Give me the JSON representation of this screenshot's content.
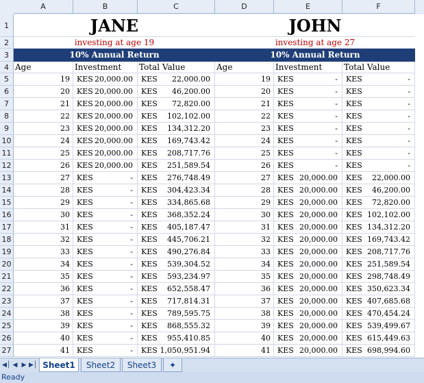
{
  "columns": [
    "A",
    "B",
    "C",
    "D",
    "E",
    "F"
  ],
  "titles": {
    "left": "JANE",
    "right": "JOHN"
  },
  "subtitles": {
    "left": "investing at age 19",
    "right": "investing at age 27"
  },
  "band": {
    "left": "10% Annual Return",
    "right": "10% Annual Return"
  },
  "headers": {
    "age": "Age",
    "investment": "Investment",
    "total": "Total Value"
  },
  "currency": "KES",
  "jane": [
    {
      "age": "19",
      "inv": "20,000.00",
      "tot": "22,000.00"
    },
    {
      "age": "20",
      "inv": "20,000.00",
      "tot": "46,200.00"
    },
    {
      "age": "21",
      "inv": "20,000.00",
      "tot": "72,820.00"
    },
    {
      "age": "22",
      "inv": "20,000.00",
      "tot": "102,102.00"
    },
    {
      "age": "23",
      "inv": "20,000.00",
      "tot": "134,312.20"
    },
    {
      "age": "24",
      "inv": "20,000.00",
      "tot": "169,743.42"
    },
    {
      "age": "25",
      "inv": "20,000.00",
      "tot": "208,717.76"
    },
    {
      "age": "26",
      "inv": "20,000.00",
      "tot": "251,589.54"
    },
    {
      "age": "27",
      "inv": "-",
      "tot": "276,748.49"
    },
    {
      "age": "28",
      "inv": "-",
      "tot": "304,423.34"
    },
    {
      "age": "29",
      "inv": "-",
      "tot": "334,865.68"
    },
    {
      "age": "30",
      "inv": "-",
      "tot": "368,352.24"
    },
    {
      "age": "31",
      "inv": "-",
      "tot": "405,187.47"
    },
    {
      "age": "32",
      "inv": "-",
      "tot": "445,706.21"
    },
    {
      "age": "33",
      "inv": "-",
      "tot": "490,276.84"
    },
    {
      "age": "34",
      "inv": "-",
      "tot": "539,304.52"
    },
    {
      "age": "35",
      "inv": "-",
      "tot": "593,234.97"
    },
    {
      "age": "36",
      "inv": "-",
      "tot": "652,558.47"
    },
    {
      "age": "37",
      "inv": "-",
      "tot": "717,814.31"
    },
    {
      "age": "38",
      "inv": "-",
      "tot": "789,595.75"
    },
    {
      "age": "39",
      "inv": "-",
      "tot": "868,555.32"
    },
    {
      "age": "40",
      "inv": "-",
      "tot": "955,410.85"
    },
    {
      "age": "41",
      "inv": "-",
      "tot": "1,050,951.94"
    }
  ],
  "john": [
    {
      "age": "19",
      "inv": "-",
      "tot": "-"
    },
    {
      "age": "20",
      "inv": "-",
      "tot": "-"
    },
    {
      "age": "21",
      "inv": "-",
      "tot": "-"
    },
    {
      "age": "22",
      "inv": "-",
      "tot": "-"
    },
    {
      "age": "23",
      "inv": "-",
      "tot": "-"
    },
    {
      "age": "24",
      "inv": "-",
      "tot": "-"
    },
    {
      "age": "25",
      "inv": "-",
      "tot": "-"
    },
    {
      "age": "26",
      "inv": "-",
      "tot": "-"
    },
    {
      "age": "27",
      "inv": "20,000.00",
      "tot": "22,000.00"
    },
    {
      "age": "28",
      "inv": "20,000.00",
      "tot": "46,200.00"
    },
    {
      "age": "29",
      "inv": "20,000.00",
      "tot": "72,820.00"
    },
    {
      "age": "30",
      "inv": "20,000.00",
      "tot": "102,102.00"
    },
    {
      "age": "31",
      "inv": "20,000.00",
      "tot": "134,312.20"
    },
    {
      "age": "32",
      "inv": "20,000.00",
      "tot": "169,743.42"
    },
    {
      "age": "33",
      "inv": "20,000.00",
      "tot": "208,717.76"
    },
    {
      "age": "34",
      "inv": "20,000.00",
      "tot": "251,589.54"
    },
    {
      "age": "35",
      "inv": "20,000.00",
      "tot": "298,748.49"
    },
    {
      "age": "36",
      "inv": "20,000.00",
      "tot": "350,623.34"
    },
    {
      "age": "37",
      "inv": "20,000.00",
      "tot": "407,685.68"
    },
    {
      "age": "38",
      "inv": "20,000.00",
      "tot": "470,454.24"
    },
    {
      "age": "39",
      "inv": "20,000.00",
      "tot": "539,499.67"
    },
    {
      "age": "40",
      "inv": "20,000.00",
      "tot": "615,449.63"
    },
    {
      "age": "41",
      "inv": "20,000.00",
      "tot": "698,994.60"
    }
  ],
  "sheet_tabs": [
    "Sheet1",
    "Sheet2",
    "Sheet3"
  ],
  "active_tab": "Sheet1",
  "status": "Ready",
  "colors": {
    "band": "#1f3e78",
    "subtitle": "#c00000",
    "header_bg": "#e6edf7"
  }
}
